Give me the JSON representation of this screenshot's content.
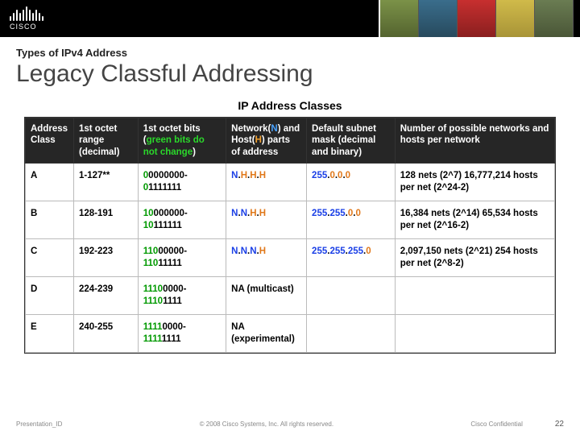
{
  "header": {
    "brand_word": "CISCO"
  },
  "slide": {
    "kicker": "Types of IPv4 Address",
    "title": "Legacy Classful Addressing",
    "table_title": "IP Address Classes"
  },
  "table": {
    "headers": {
      "col_a": "Address Class",
      "col_b": "1st octet range (decimal)",
      "col_c_pre": "1st octet bits (",
      "col_c_green": "green bits do not change",
      "col_c_post": ")",
      "col_d_pre": "Network(",
      "col_d_n": "N",
      "col_d_mid": ") and Host(",
      "col_d_h": "H",
      "col_d_post": ") parts of address",
      "col_e": "Default subnet mask (decimal and binary)",
      "col_f": "Number of possible networks and hosts per network"
    },
    "rows": [
      {
        "class": "A",
        "range": "1-127**",
        "bits_fixed": "0",
        "bits_var1": "0000000-",
        "bits_fixed2": "0",
        "bits_var2": "1111111",
        "pattern": [
          "N",
          ".",
          "H",
          ".",
          "H",
          ".",
          "H"
        ],
        "mask": [
          "255",
          ".",
          "0",
          ".",
          "0",
          ".",
          "0"
        ],
        "count": "128 nets (2^7) 16,777,214 hosts per net (2^24-2)"
      },
      {
        "class": "B",
        "range": "128-191",
        "bits_fixed": "10",
        "bits_var1": "000000-",
        "bits_fixed2": "10",
        "bits_var2": "111111",
        "pattern": [
          "N",
          ".",
          "N",
          ".",
          "H",
          ".",
          "H"
        ],
        "mask": [
          "255",
          ".",
          "255",
          ".",
          "0",
          ".",
          "0"
        ],
        "count": "16,384 nets (2^14) 65,534 hosts per net (2^16-2)"
      },
      {
        "class": "C",
        "range": "192-223",
        "bits_fixed": "110",
        "bits_var1": "00000-",
        "bits_fixed2": "110",
        "bits_var2": "11111",
        "pattern": [
          "N",
          ".",
          "N",
          ".",
          "N",
          ".",
          "H"
        ],
        "mask": [
          "255",
          ".",
          "255",
          ".",
          "255",
          ".",
          "0"
        ],
        "count": "2,097,150 nets (2^21) 254 hosts per net (2^8-2)"
      },
      {
        "class": "D",
        "range": "224-239",
        "bits_fixed": "1110",
        "bits_var1": "0000-",
        "bits_fixed2": "1110",
        "bits_var2": "1111",
        "pattern_text": "NA (multicast)",
        "mask_text": "",
        "count": ""
      },
      {
        "class": "E",
        "range": "240-255",
        "bits_fixed": "1111",
        "bits_var1": "0000-",
        "bits_fixed2": "1111",
        "bits_var2": "1111",
        "pattern_text": "NA (experimental)",
        "mask_text": "",
        "count": ""
      }
    ]
  },
  "footer": {
    "left": "Presentation_ID",
    "center": "© 2008 Cisco Systems, Inc. All rights reserved.",
    "confidential": "Cisco Confidential",
    "page": "22"
  }
}
